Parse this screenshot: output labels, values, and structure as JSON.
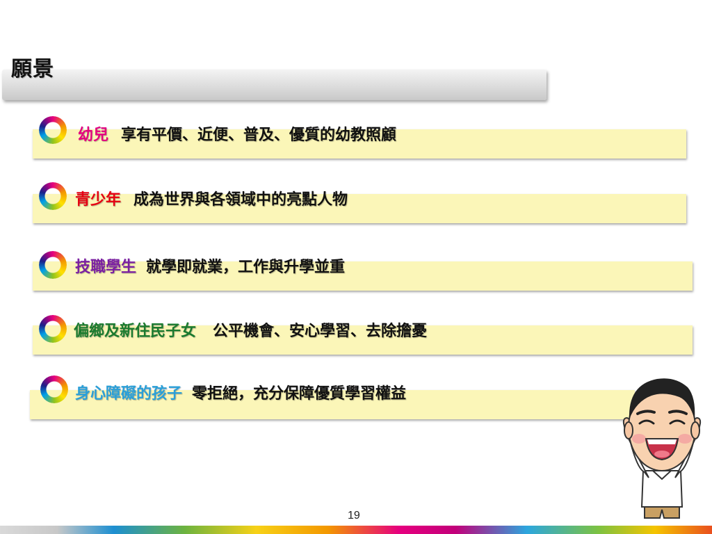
{
  "slide": {
    "title": "願景",
    "page_number": "19"
  },
  "rows": [
    {
      "label": "幼兒",
      "desc": "享有平價、近便、普及、優質的幼教照顧",
      "label_color": "#e4007f"
    },
    {
      "label": "青少年",
      "desc": "成為世界與各領域中的亮點人物",
      "label_color": "#e60012"
    },
    {
      "label": "技職學生",
      "desc": "就學即就業，工作與升學並重",
      "label_color": "#7b1fa2"
    },
    {
      "label": "偏鄉及新住民子女",
      "desc": "公平機會、安心學習、去除擔憂",
      "label_color": "#1a7a2e"
    },
    {
      "label": "身心障礙的孩子",
      "desc": "零拒絕，充分保障優質學習權益",
      "label_color": "#2a9fd8"
    }
  ],
  "colors": {
    "row_background": "#fbf6b8",
    "title_bar": "#dcdcdc"
  },
  "icons": [
    "ring-bullet-icon",
    "mascot-cartoon"
  ]
}
